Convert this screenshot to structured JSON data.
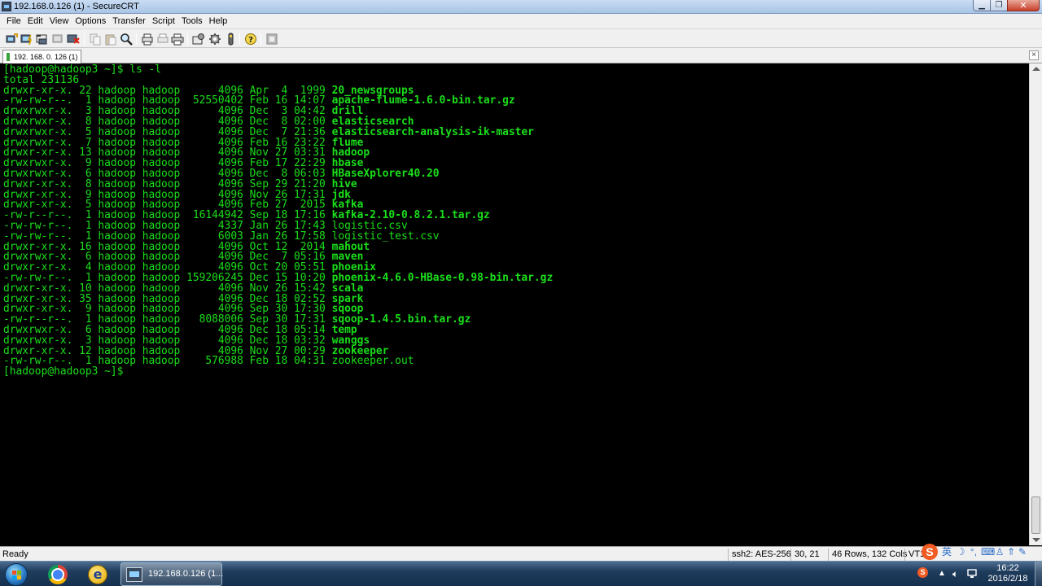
{
  "window": {
    "title": "192.168.0.126 (1) - SecureCRT"
  },
  "menu": [
    "File",
    "Edit",
    "View",
    "Options",
    "Transfer",
    "Script",
    "Tools",
    "Help"
  ],
  "toolbar": {
    "icons": [
      "connect-icon",
      "quick-connect-icon",
      "connect-in-tab-icon",
      "reconnect-icon",
      "disconnect-icon",
      "copy-icon",
      "paste-icon",
      "find-icon",
      "print-screen-icon",
      "print-selection-icon",
      "print-icon",
      "session-options-icon",
      "global-options-icon",
      "keymap-icon",
      "help-icon",
      "sftp-icon"
    ]
  },
  "tab": {
    "label": "192. 168. 0. 126  (1)",
    "close": "×"
  },
  "terminal": {
    "prompt_line": "[hadoop@hadoop3 ~]$ ls -l",
    "total_line": "total 231136",
    "entries": [
      {
        "meta": "drwxr-xr-x. 22 hadoop hadoop      4096 Apr  4  1999 ",
        "name": "20_newsgroups",
        "dir": true
      },
      {
        "meta": "-rw-rw-r--.  1 hadoop hadoop  52550402 Feb 16 14:07 ",
        "name": "apache-flume-1.6.0-bin.tar.gz",
        "dir": true
      },
      {
        "meta": "drwxrwxr-x.  3 hadoop hadoop      4096 Dec  3 04:42 ",
        "name": "drill",
        "dir": true
      },
      {
        "meta": "drwxrwxr-x.  8 hadoop hadoop      4096 Dec  8 02:00 ",
        "name": "elasticsearch",
        "dir": true
      },
      {
        "meta": "drwxrwxr-x.  5 hadoop hadoop      4096 Dec  7 21:36 ",
        "name": "elasticsearch-analysis-ik-master",
        "dir": true
      },
      {
        "meta": "drwxrwxr-x.  7 hadoop hadoop      4096 Feb 16 23:22 ",
        "name": "flume",
        "dir": true
      },
      {
        "meta": "drwxr-xr-x. 13 hadoop hadoop      4096 Nov 27 03:31 ",
        "name": "hadoop",
        "dir": true
      },
      {
        "meta": "drwxrwxr-x.  9 hadoop hadoop      4096 Feb 17 22:29 ",
        "name": "hbase",
        "dir": true
      },
      {
        "meta": "drwxrwxr-x.  6 hadoop hadoop      4096 Dec  8 06:03 ",
        "name": "HBaseXplorer40.20",
        "dir": true
      },
      {
        "meta": "drwxr-xr-x.  8 hadoop hadoop      4096 Sep 29 21:20 ",
        "name": "hive",
        "dir": true
      },
      {
        "meta": "drwxr-xr-x.  9 hadoop hadoop      4096 Nov 26 17:31 ",
        "name": "jdk",
        "dir": true
      },
      {
        "meta": "drwxr-xr-x.  5 hadoop hadoop      4096 Feb 27  2015 ",
        "name": "kafka",
        "dir": true
      },
      {
        "meta": "-rw-r--r--.  1 hadoop hadoop  16144942 Sep 18 17:16 ",
        "name": "kafka-2.10-0.8.2.1.tar.gz",
        "dir": true
      },
      {
        "meta": "-rw-rw-r--.  1 hadoop hadoop      4337 Jan 26 17:43 ",
        "name": "logistic.csv",
        "dir": false
      },
      {
        "meta": "-rw-rw-r--.  1 hadoop hadoop      6003 Jan 26 17:58 ",
        "name": "logistic_test.csv",
        "dir": false
      },
      {
        "meta": "drwxr-xr-x. 16 hadoop hadoop      4096 Oct 12  2014 ",
        "name": "mahout",
        "dir": true
      },
      {
        "meta": "drwxrwxr-x.  6 hadoop hadoop      4096 Dec  7 05:16 ",
        "name": "maven",
        "dir": true
      },
      {
        "meta": "drwxr-xr-x.  4 hadoop hadoop      4096 Oct 20 05:51 ",
        "name": "phoenix",
        "dir": true
      },
      {
        "meta": "-rw-rw-r--.  1 hadoop hadoop 159206245 Dec 15 10:20 ",
        "name": "phoenix-4.6.0-HBase-0.98-bin.tar.gz",
        "dir": true
      },
      {
        "meta": "drwxr-xr-x. 10 hadoop hadoop      4096 Nov 26 15:42 ",
        "name": "scala",
        "dir": true
      },
      {
        "meta": "drwxr-xr-x. 35 hadoop hadoop      4096 Dec 18 02:52 ",
        "name": "spark",
        "dir": true
      },
      {
        "meta": "drwxr-xr-x.  9 hadoop hadoop      4096 Sep 30 17:30 ",
        "name": "sqoop",
        "dir": true
      },
      {
        "meta": "-rw-r--r--.  1 hadoop hadoop   8088006 Sep 30 17:31 ",
        "name": "sqoop-1.4.5.bin.tar.gz",
        "dir": true
      },
      {
        "meta": "drwxrwxr-x.  6 hadoop hadoop      4096 Dec 18 05:14 ",
        "name": "temp",
        "dir": true
      },
      {
        "meta": "drwxrwxr-x.  3 hadoop hadoop      4096 Dec 18 03:32 ",
        "name": "wanggs",
        "dir": true
      },
      {
        "meta": "drwxr-xr-x. 12 hadoop hadoop      4096 Nov 27 00:29 ",
        "name": "zookeeper",
        "dir": true
      },
      {
        "meta": "-rw-rw-r--.  1 hadoop hadoop    576988 Feb 18 04:31 ",
        "name": "zookeeper.out",
        "dir": false
      }
    ],
    "final_prompt": "[hadoop@hadoop3 ~]$ ",
    "text_color": "#1adf1a",
    "background": "#000000"
  },
  "status": {
    "ready": "Ready",
    "cipher": "ssh2: AES-256",
    "cursor": "30,  21",
    "size": "46 Rows, 132 Cols",
    "term": "VT1"
  },
  "ime": {
    "logo": "S",
    "lang": "英"
  },
  "taskbar": {
    "app_label": "192.168.0.126 (1...",
    "time": "16:22",
    "date": "2016/2/18",
    "tray_badge": "S"
  }
}
